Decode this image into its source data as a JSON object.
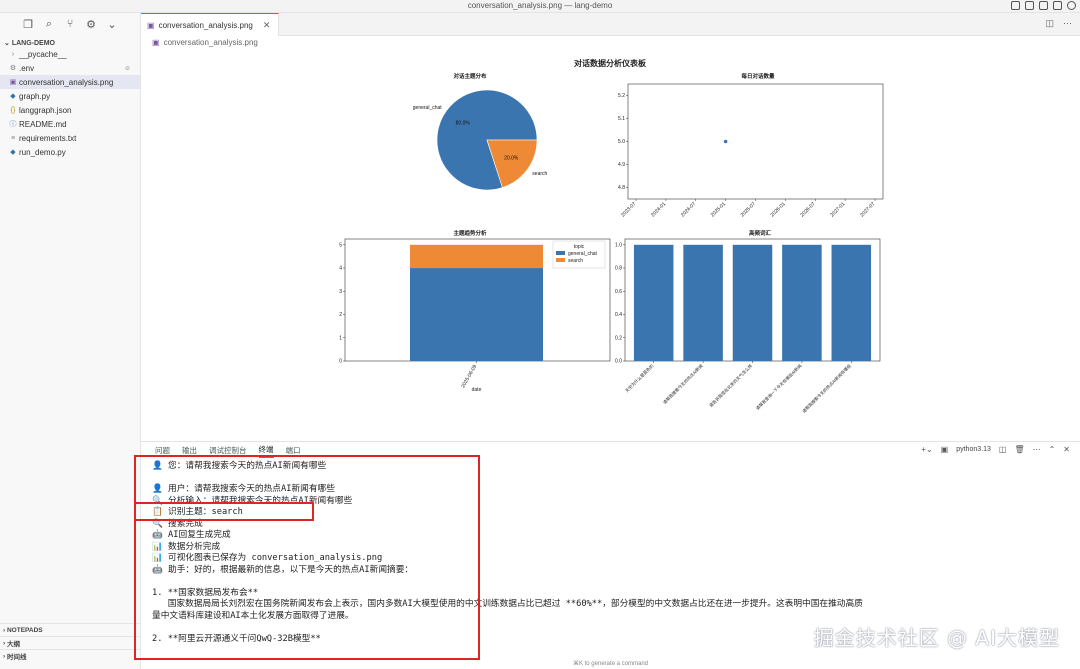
{
  "window": {
    "title": "conversation_analysis.png — lang-demo"
  },
  "sidebar": {
    "project": "LANG-DEMO",
    "files": [
      {
        "name": "__pycache__",
        "icon": "chevron-right-icon",
        "kind": "folder"
      },
      {
        "name": ".env",
        "icon": "gear-icon",
        "kind": "env",
        "badge": "⊘"
      },
      {
        "name": "conversation_analysis.png",
        "icon": "image-icon",
        "kind": "png",
        "active": true
      },
      {
        "name": "graph.py",
        "icon": "python-icon",
        "kind": "py"
      },
      {
        "name": "langgraph.json",
        "icon": "json-icon",
        "kind": "json"
      },
      {
        "name": "README.md",
        "icon": "info-icon",
        "kind": "info"
      },
      {
        "name": "requirements.txt",
        "icon": "text-file-icon",
        "kind": "txt"
      },
      {
        "name": "run_demo.py",
        "icon": "python-icon",
        "kind": "py"
      }
    ],
    "bottom_sections": [
      "NOTEPADS",
      "大纲",
      "时间线"
    ]
  },
  "editor": {
    "tab_label": "conversation_analysis.png",
    "breadcrumb": "conversation_analysis.png"
  },
  "chart_data": [
    {
      "type": "pie",
      "suptitle": "对话数据分析仪表板",
      "title": "对话主题分布",
      "labels": [
        "general_chat",
        "search"
      ],
      "values": [
        80.0,
        20.0
      ],
      "value_labels": [
        "80.0%",
        "20.0%"
      ],
      "colors": [
        "#3a75af",
        "#ee8a35"
      ]
    },
    {
      "type": "scatter",
      "title": "每日对话数量",
      "x": [
        "2025-01"
      ],
      "y": [
        5
      ],
      "xticks": [
        "2023-07",
        "2024-01",
        "2024-07",
        "2025-01",
        "2025-07",
        "2026-01",
        "2026-07",
        "2027-01",
        "2027-07"
      ],
      "yticks": [
        "4.8",
        "4.9",
        "5.0",
        "5.1",
        "5.2"
      ],
      "ylim": [
        4.75,
        5.25
      ],
      "color": "#3a75af"
    },
    {
      "type": "bar",
      "title": "主题趋势分析",
      "stacked": true,
      "categories": [
        "2025-06-09"
      ],
      "series": [
        {
          "name": "general_chat",
          "values": [
            4
          ],
          "color": "#3a75af"
        },
        {
          "name": "search",
          "values": [
            1
          ],
          "color": "#ee8a35"
        }
      ],
      "legend_title": "topic",
      "legend_position": "upper right",
      "yticks": [
        "0",
        "1",
        "2",
        "3",
        "4",
        "5"
      ],
      "ylim": [
        0,
        5.25
      ],
      "xlabel": "date"
    },
    {
      "type": "bar",
      "title": "高频词汇",
      "categories": [
        "天空为什么是蓝色的",
        "请帮我搜索今天的热点AI新闻",
        "请告诉我现在北京的天气怎么样",
        "请帮我查询一下今天有哪些AI新闻",
        "请帮我搜索今天的热点AI新闻有哪些"
      ],
      "values": [
        1.0,
        1.0,
        1.0,
        1.0,
        1.0
      ],
      "yticks": [
        "0.0",
        "0.2",
        "0.4",
        "0.6",
        "0.8",
        "1.0"
      ],
      "ylim": [
        0,
        1.05
      ],
      "color": "#3a75af"
    }
  ],
  "panel": {
    "tabs": [
      "问题",
      "输出",
      "调试控制台",
      "终端",
      "端口"
    ],
    "active_tab": "终端",
    "python_version": "python3.13",
    "lines": [
      "👤 您：请帮我搜索今天的热点AI新闻有哪些",
      "",
      "👤 用户：请帮我搜索今天的热点AI新闻有哪些",
      "🔍 分析输入：请帮我搜索今天的热点AI新闻有哪些",
      "📋 识别主题：search",
      "🔍 搜索完成",
      "🤖 AI回复生成完成",
      "📊 数据分析完成",
      "📊 可视化图表已保存为 conversation_analysis.png",
      "🤖 助手：好的，根据最新的信息，以下是今天的热点AI新闻摘要：",
      "",
      "1. **国家数据局发布会**",
      "   国家数据局局长刘烈宏在国务院新闻发布会上表示，国内多数AI大模型使用的中文训练数据占比已超过 **60%**，部分模型的中文数据占比还在进一步提升。这表明中国在推动高质",
      "量中文语料库建设和AI本土化发展方面取得了进展。",
      "",
      "2. **阿里云开源通义千问QwQ-32B模型**"
    ],
    "cmd_hint": "⌘K to generate a command"
  },
  "watermark": "掘金技术社区 @ AI大模型"
}
